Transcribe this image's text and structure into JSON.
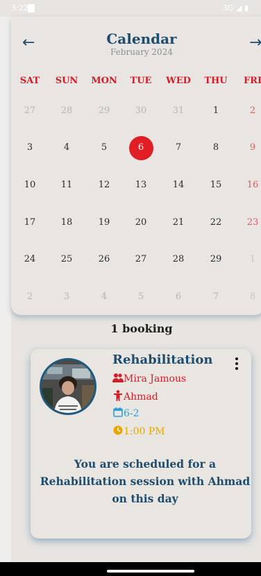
{
  "status_bar": {
    "time": "3:22",
    "network": "3G"
  },
  "header": {
    "title": "Calendar",
    "subtitle": "February 2024",
    "prev_icon": "arrow-left-icon",
    "next_icon": "arrow-right-icon"
  },
  "calendar": {
    "weekdays": [
      "SAT",
      "SUN",
      "MON",
      "TUE",
      "WED",
      "THU",
      "FRI"
    ],
    "weeks": [
      [
        "27",
        "28",
        "29",
        "30",
        "31",
        "1",
        "2"
      ],
      [
        "3",
        "4",
        "5",
        "6",
        "7",
        "8",
        "9"
      ],
      [
        "10",
        "11",
        "12",
        "13",
        "14",
        "15",
        "16"
      ],
      [
        "17",
        "18",
        "19",
        "20",
        "21",
        "22",
        "23"
      ],
      [
        "24",
        "25",
        "26",
        "27",
        "28",
        "29",
        "1"
      ],
      [
        "2",
        "3",
        "4",
        "5",
        "6",
        "7",
        "8"
      ]
    ],
    "selected": "6"
  },
  "bookings": {
    "count_label": "1 booking",
    "items": [
      {
        "title": "Rehabilitation",
        "therapist": "Mira Jamous",
        "patient": "Ahmad",
        "date": "6-2",
        "time": "1:00 PM",
        "note": "You are scheduled for a Rehabilitation session with Ahmad on this day"
      }
    ]
  },
  "colors": {
    "accent": "#1e4d70",
    "weekend": "#d51c24",
    "selected": "#e01e25",
    "date_icon": "#2a9fd8",
    "time_icon": "#e6a800"
  }
}
